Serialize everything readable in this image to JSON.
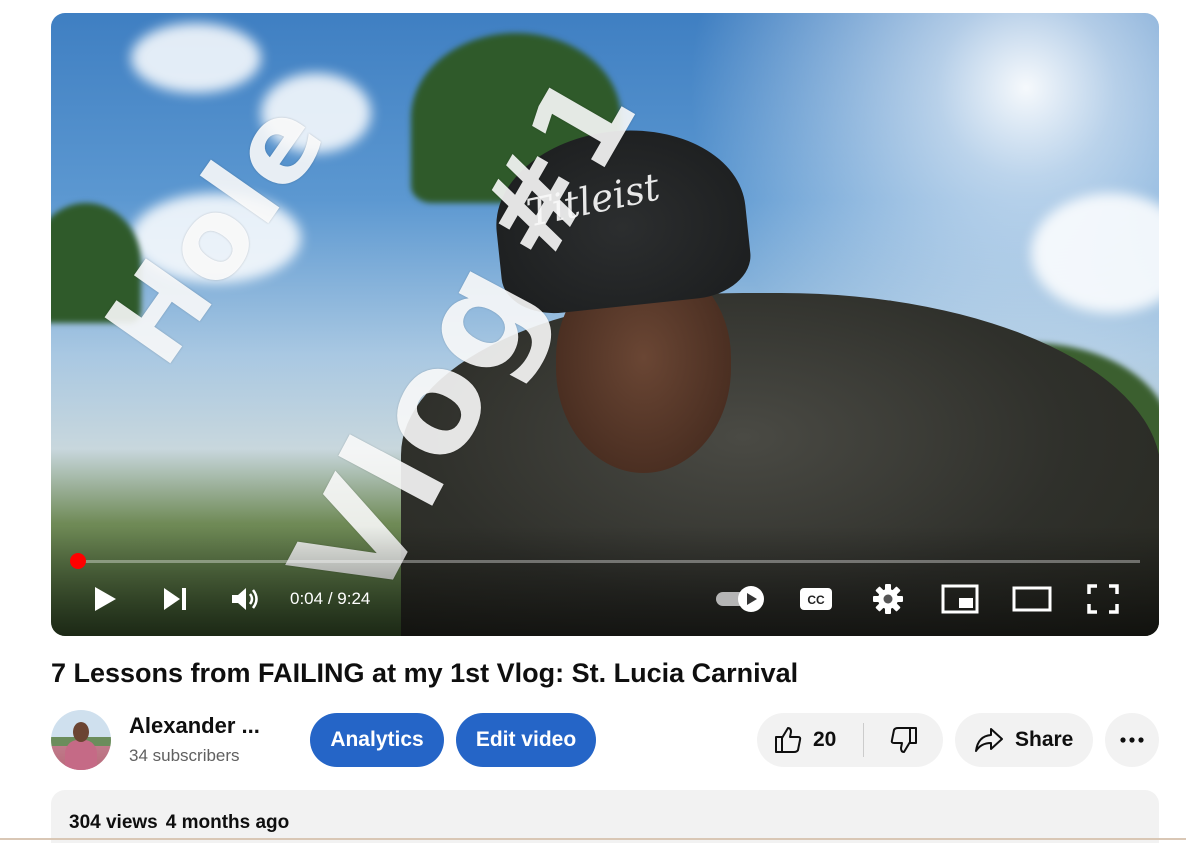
{
  "player": {
    "current_time": "0:04",
    "separator": " / ",
    "duration": "9:24",
    "progress_fraction": 0.007,
    "overlay_text": {
      "line1": "Hole",
      "line2": "Vlog",
      "line3": "#1"
    },
    "cap_text": "Titleist"
  },
  "video": {
    "title": "7 Lessons from FAILING at my 1st Vlog: St. Lucia Carnival"
  },
  "channel": {
    "name": "Alexander ...",
    "subscribers": "34 subscribers"
  },
  "actions": {
    "analytics_label": "Analytics",
    "edit_label": "Edit video",
    "like_count": "20",
    "share_label": "Share"
  },
  "description": {
    "views": "304 views",
    "age": "4 months ago"
  },
  "colors": {
    "progress": "#ff0000",
    "primary_button": "#2565c7",
    "grey_pill": "#f2f2f2"
  },
  "icons": [
    "play-icon",
    "next-icon",
    "volume-icon",
    "autoplay-toggle-icon",
    "cc-icon",
    "settings-icon",
    "miniplayer-icon",
    "theater-icon",
    "fullscreen-icon",
    "thumbs-up-icon",
    "thumbs-down-icon",
    "share-icon",
    "more-icon"
  ]
}
